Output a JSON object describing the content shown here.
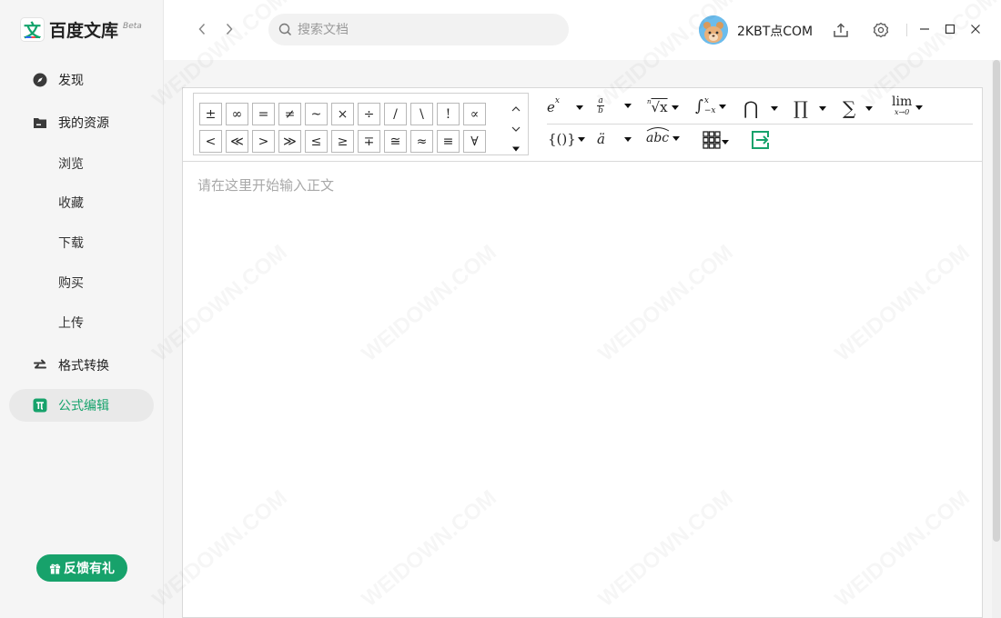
{
  "brand": {
    "logo_char": "文",
    "name": "百度文库",
    "badge": "Beta"
  },
  "sidebar": {
    "items": [
      {
        "label": "发现",
        "icon": "compass-icon"
      },
      {
        "label": "我的资源",
        "icon": "folder-icon"
      },
      {
        "label": "浏览"
      },
      {
        "label": "收藏"
      },
      {
        "label": "下载"
      },
      {
        "label": "购买"
      },
      {
        "label": "上传"
      },
      {
        "label": "格式转换",
        "icon": "swap-arrows-icon"
      },
      {
        "label": "公式编辑",
        "icon": "pi-icon",
        "active": true
      }
    ],
    "feedback_label": "反馈有礼"
  },
  "topbar": {
    "search_placeholder": "搜索文档",
    "username": "2KBT点COM"
  },
  "editor": {
    "symbols_row1": [
      "±",
      "∞",
      "=",
      "≠",
      "~",
      "×",
      "÷",
      "/",
      "\\",
      "!",
      "∝"
    ],
    "symbols_row2": [
      "<",
      "≪",
      ">",
      "≫",
      "≤",
      "≥",
      "∓",
      "≅",
      "≈",
      "≡",
      "∀"
    ],
    "templates": {
      "exponent": "e",
      "exponent_sup": "x",
      "fraction_num": "a",
      "fraction_den": "b",
      "radical_index": "n",
      "radical": "√x",
      "integral": "∫",
      "integral_upper": "x",
      "integral_lower": "−x",
      "intersection": "⋂",
      "product": "∏",
      "sum": "∑",
      "limit": "lim",
      "limit_sub": "x→0",
      "brackets": "{()}",
      "accent": "ä",
      "overarc": "abc"
    },
    "placeholder": "请在这里开始输入正文"
  },
  "watermark": "WEIDOWN.COM",
  "colors": {
    "accent": "#17a26b",
    "active_bg": "#e9e9e9"
  }
}
